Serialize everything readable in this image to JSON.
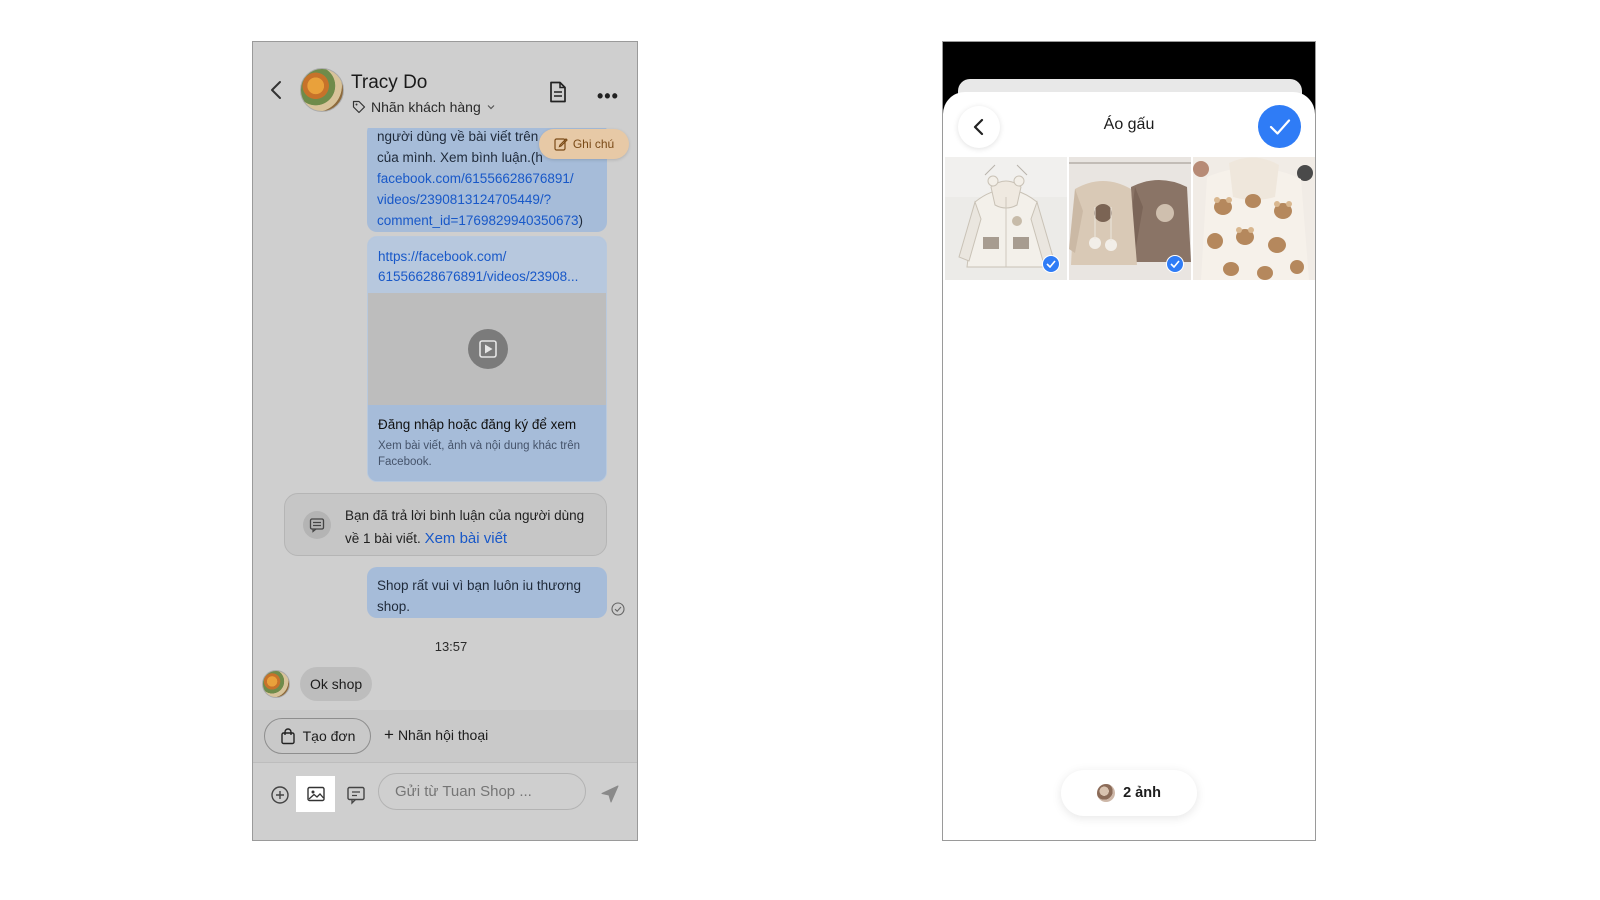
{
  "chat": {
    "contact_name": "Tracy Do",
    "label_tag": "Nhãn khách hàng",
    "note_button": "Ghi chú",
    "msg1_text_line1": "người dùng về bài viết trên",
    "msg1_text_line2": "của mình. Xem bình luận.(h",
    "msg1_link_line1": "facebook.com/61556628676891/",
    "msg1_link_line2": "videos/2390813124705449/?",
    "msg1_link_line3": "comment_id=1769829940350673",
    "msg1_close": ")",
    "link_card": {
      "url_line1": "https://facebook.com/",
      "url_line2": "61556628676891/videos/23908...",
      "title": "Đăng nhập hoặc đăng ký để xem",
      "description": "Xem bài viết, ảnh và nội dung khác trên Facebook."
    },
    "system_notice": {
      "text": "Bạn đã trả lời bình luận của người dùng về 1 bài viết.",
      "link": "Xem bài viết"
    },
    "msg2_text": "Shop rất vui vì bạn luôn iu thương shop.",
    "timestamp": "13:57",
    "incoming_text": "Ok shop",
    "create_order_button": "Tạo đơn",
    "conversation_label_button": "Nhãn hội thoại",
    "input_placeholder": "Gửi từ Tuan Shop ..."
  },
  "picker": {
    "album_title": "Áo gấu",
    "selected_count": "2 ảnh",
    "photos": [
      {
        "selected": true
      },
      {
        "selected": true
      },
      {
        "selected": false
      }
    ]
  },
  "colors": {
    "accent_blue": "#2f7cf6",
    "link_blue": "#1858c8",
    "outgoing_bubble": "#a6bcd9",
    "note_button": "#e7c9a6"
  }
}
